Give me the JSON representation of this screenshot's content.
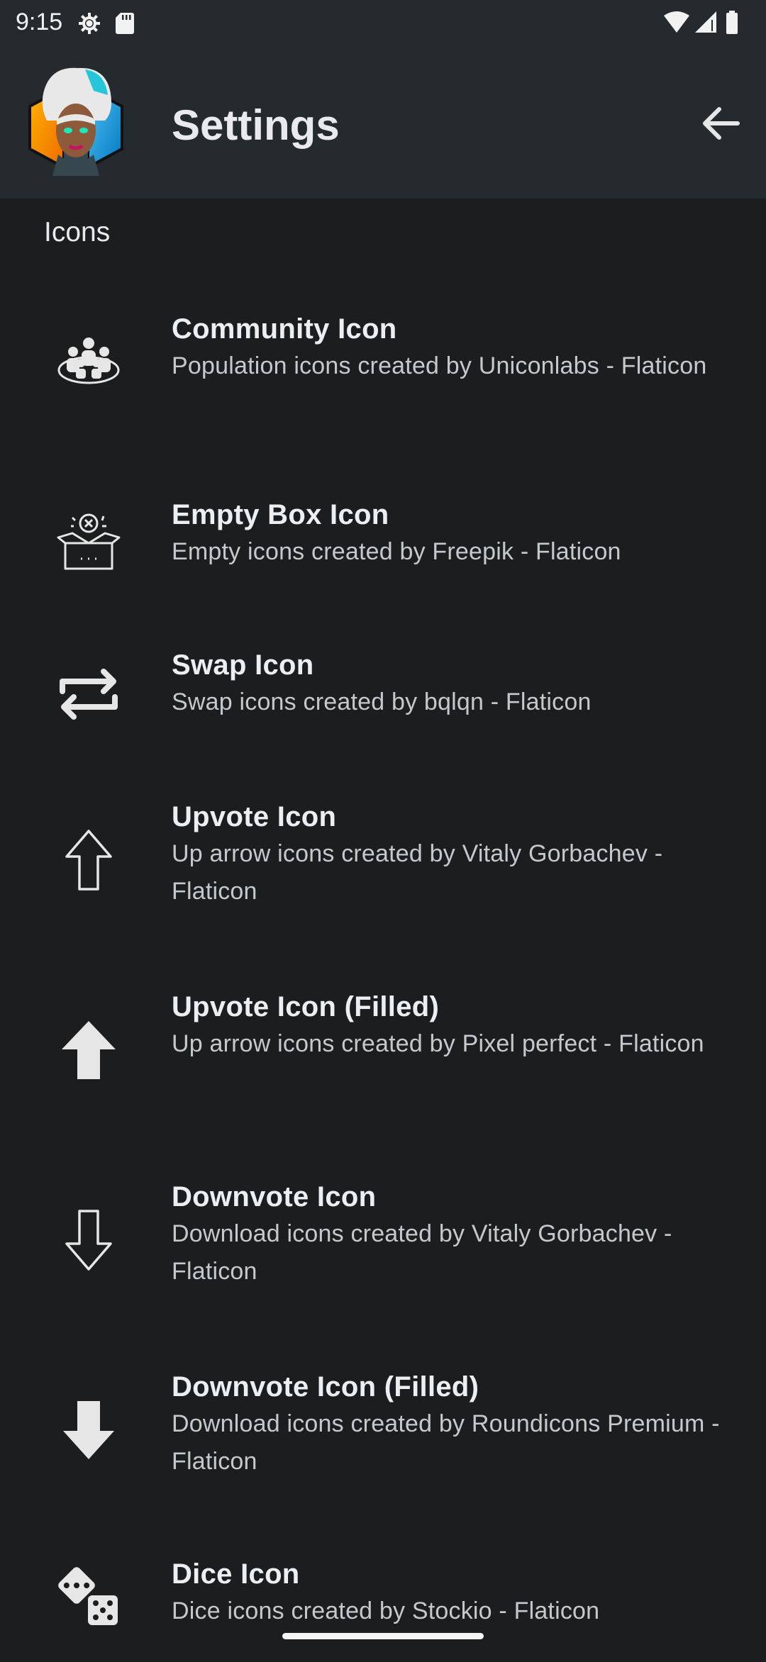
{
  "status_bar": {
    "time": "9:15"
  },
  "app_bar": {
    "title": "Settings"
  },
  "section": {
    "title": "Icons"
  },
  "items": [
    {
      "title": "Community Icon",
      "subtitle": "Population icons created by Uniconlabs - Flaticon",
      "icon": "community-icon"
    },
    {
      "title": "Empty Box Icon",
      "subtitle": "Empty icons created by Freepik - Flaticon",
      "icon": "empty-box-icon"
    },
    {
      "title": "Swap Icon",
      "subtitle": "Swap icons created by bqlqn - Flaticon",
      "icon": "swap-icon"
    },
    {
      "title": "Upvote Icon",
      "subtitle": "Up arrow icons created by Vitaly Gorbachev - Flaticon",
      "icon": "upvote-outline-icon"
    },
    {
      "title": "Upvote Icon (Filled)",
      "subtitle": "Up arrow icons created by Pixel perfect - Flaticon",
      "icon": "upvote-filled-icon"
    },
    {
      "title": "Downvote Icon",
      "subtitle": "Download icons created by Vitaly Gorbachev - Flaticon",
      "icon": "downvote-outline-icon"
    },
    {
      "title": "Downvote Icon (Filled)",
      "subtitle": "Download icons created by Roundicons Premium - Flaticon",
      "icon": "downvote-filled-icon"
    },
    {
      "title": "Dice Icon",
      "subtitle": "Dice icons created by Stockio - Flaticon",
      "icon": "dice-icon"
    }
  ],
  "colors": {
    "app_bar_bg": "#242a2e",
    "page_bg": "#1b1d1f",
    "text_primary": "#eceff1",
    "text_secondary": "#c5c9cc"
  }
}
